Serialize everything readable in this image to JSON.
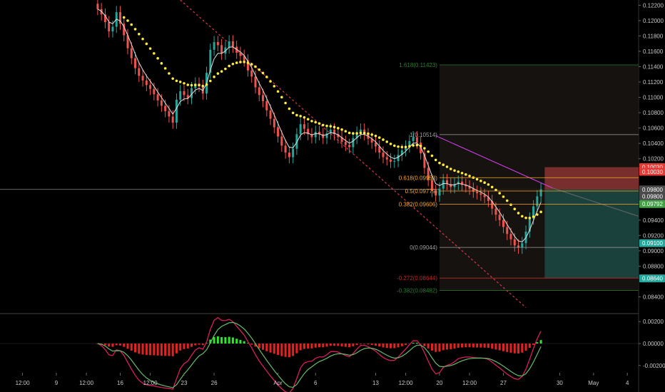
{
  "chart_data": {
    "type": "line",
    "instrument_view": "candlestick price chart with moving averages, fibonacci retracement, trendline, long/short position box and histogram oscillator",
    "price_axis": {
      "ylim": [
        0.082,
        0.1225
      ],
      "ticks": [
        "0.12200",
        "0.12000",
        "0.11800",
        "0.11600",
        "0.11400",
        "0.11200",
        "0.11000",
        "0.10800",
        "0.10600",
        "0.10400",
        "0.10200",
        "0.09400",
        "0.09200",
        "0.09000",
        "0.08800",
        "0.08400"
      ],
      "tick_values": [
        0.122,
        0.12,
        0.118,
        0.116,
        0.114,
        0.112,
        0.11,
        0.108,
        0.106,
        0.104,
        0.102,
        0.094,
        0.092,
        0.09,
        0.088,
        0.084
      ]
    },
    "price_tags": [
      {
        "text": "0.10030",
        "value": 0.1009,
        "color": "#e53935"
      },
      {
        "text": "0.10030",
        "value": 0.1003,
        "color": "#e53935"
      },
      {
        "text": "0.09800",
        "value": 0.098,
        "color": "#4a4a4a"
      },
      {
        "text": "0.09800",
        "value": 0.0971,
        "color": "#4a4a4a"
      },
      {
        "text": "0.09792",
        "value": 0.0961,
        "color": "#43a047"
      },
      {
        "text": "0.09100",
        "value": 0.091,
        "color": "#26a69a"
      },
      {
        "text": "0.08640",
        "value": 0.0864,
        "color": "#26a69a"
      }
    ],
    "fib_levels": [
      {
        "label": "1.618(0.11423)",
        "value": 0.11423,
        "color": "#2e7d32"
      },
      {
        "label": "1(0.10514)",
        "value": 0.10514,
        "color": "#9e9e9e"
      },
      {
        "label": "0.618(0.09953)",
        "value": 0.09953,
        "color": "#f9a825"
      },
      {
        "label": "0.5(0.09779)",
        "value": 0.09779,
        "color": "#f9a825"
      },
      {
        "label": "0.382(0.09606)",
        "value": 0.09606,
        "color": "#f9a825"
      },
      {
        "label": "0(0.09044)",
        "value": 0.09044,
        "color": "#9e9e9e"
      },
      {
        "label": "-0.272(0.08644)",
        "value": 0.08644,
        "color": "#c62828"
      },
      {
        "label": "-0.382(0.08482)",
        "value": 0.08482,
        "color": "#2e7d32"
      }
    ],
    "horizontal_line": 0.098,
    "position": {
      "entry": 0.098,
      "stop": 0.1009,
      "target": 0.0864,
      "colors": {
        "stop": "#ef5350",
        "target": "#26a69a"
      }
    },
    "time_axis": {
      "labels": [
        "12:00",
        "9",
        "12:00",
        "16",
        "12:00",
        "23",
        "26",
        "Apr",
        "6",
        "13",
        "12:00",
        "20",
        "12:00",
        "27",
        "30",
        "May",
        "4"
      ],
      "index": [
        6,
        15,
        23,
        32,
        40,
        49,
        57,
        74,
        84,
        100,
        108,
        117,
        125,
        134,
        149,
        158,
        167
      ]
    },
    "oscillator": {
      "ticks": [
        "0.00200",
        "0.00000",
        "-0.00200"
      ],
      "tick_values": [
        0.002,
        0,
        -0.002
      ],
      "ylim": [
        -0.0026,
        0.0026
      ]
    },
    "candles_count": 148,
    "close": [
      0.1215,
      0.1208,
      0.1198,
      0.1186,
      0.1192,
      0.1211,
      0.1196,
      0.1181,
      0.1164,
      0.1151,
      0.1138,
      0.1128,
      0.1122,
      0.1116,
      0.1111,
      0.1104,
      0.1096,
      0.1089,
      0.1082,
      0.1075,
      0.1067,
      0.1097,
      0.1108,
      0.1103,
      0.1099,
      0.1112,
      0.1118,
      0.1115,
      0.1105,
      0.1132,
      0.1162,
      0.1172,
      0.1168,
      0.1157,
      0.1165,
      0.1173,
      0.1166,
      0.1158,
      0.1154,
      0.1148,
      0.1135,
      0.1127,
      0.1113,
      0.1103,
      0.1095,
      0.1083,
      0.1072,
      0.1061,
      0.1049,
      0.1037,
      0.1028,
      0.1022,
      0.1033,
      0.1052,
      0.1065,
      0.1059,
      0.1052,
      0.1048,
      0.1055,
      0.1052,
      0.1047,
      0.1053,
      0.1058,
      0.1052,
      0.1048,
      0.1042,
      0.1038,
      0.1035,
      0.1047,
      0.1054,
      0.1058,
      0.1052,
      0.1046,
      0.1041,
      0.1036,
      0.1028,
      0.1022,
      0.1019,
      0.1016,
      0.1017,
      0.1025,
      0.1031,
      0.1036,
      0.1043,
      0.1048,
      0.1041,
      0.1027,
      0.1008,
      0.0992,
      0.0978,
      0.0972,
      0.0981,
      0.0992,
      0.0987,
      0.0983,
      0.0987,
      0.099,
      0.0986,
      0.0984,
      0.0981,
      0.0977,
      0.0975,
      0.0973,
      0.097,
      0.0965,
      0.0955,
      0.0947,
      0.094,
      0.0931,
      0.0922,
      0.0915,
      0.0907,
      0.0904,
      0.091,
      0.0925,
      0.0942,
      0.0958,
      0.0971,
      0.098
    ]
  }
}
